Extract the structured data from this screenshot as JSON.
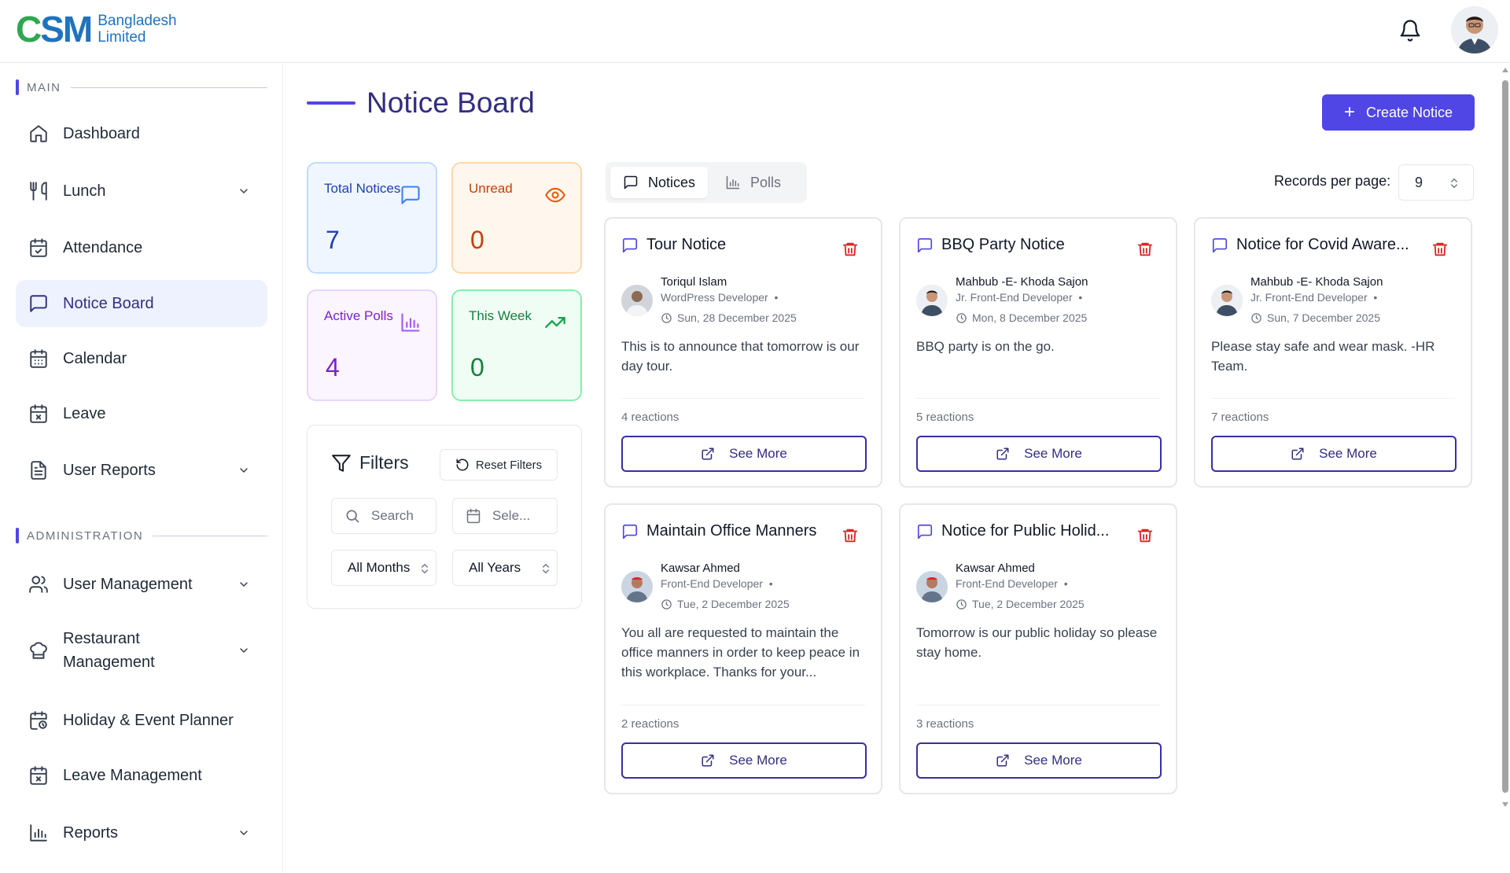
{
  "brand": {
    "mark_c": "C",
    "mark_sm": "SM",
    "line1": "Bangladesh",
    "line2": "Limited"
  },
  "sidebar": {
    "main_label": "MAIN",
    "admin_label": "ADMINISTRATION",
    "items": [
      {
        "label": "Dashboard",
        "icon": "home-icon"
      },
      {
        "label": "Lunch",
        "icon": "utensils-icon"
      },
      {
        "label": "Attendance",
        "icon": "calendar-check-icon"
      },
      {
        "label": "Notice Board",
        "icon": "message-square-icon"
      },
      {
        "label": "Calendar",
        "icon": "calendar-icon"
      },
      {
        "label": "Leave",
        "icon": "calendar-x-icon"
      },
      {
        "label": "User Reports",
        "icon": "file-text-icon"
      }
    ],
    "admin_items": [
      {
        "label": "User Management",
        "icon": "users-icon"
      },
      {
        "label": "Restaurant",
        "label2": "Management",
        "icon": "chef-hat-icon"
      },
      {
        "label": "Holiday & Event Planner",
        "icon": "calendar-clock-icon"
      },
      {
        "label": "Leave Management",
        "icon": "calendar-x-icon"
      },
      {
        "label": "Reports",
        "icon": "bar-chart-icon"
      }
    ]
  },
  "page": {
    "title": "Notice Board",
    "create_label": "Create Notice"
  },
  "stats": [
    {
      "label": "Total Notices",
      "value": "7",
      "icon": "message-square-icon",
      "color": "#1e40af"
    },
    {
      "label": "Unread",
      "value": "0",
      "icon": "eye-icon",
      "color": "#c2410c"
    },
    {
      "label": "Active Polls",
      "value": "4",
      "icon": "bar-chart-icon",
      "color": "#7e22ce"
    },
    {
      "label": "This Week",
      "value": "0",
      "icon": "trending-up-icon",
      "color": "#15803d"
    }
  ],
  "filters": {
    "title": "Filters",
    "reset_label": "Reset Filters",
    "search_placeholder": "Search",
    "date_placeholder": "Sele...",
    "month_value": "All Months",
    "year_value": "All Years"
  },
  "tabs": [
    {
      "label": "Notices"
    },
    {
      "label": "Polls"
    }
  ],
  "records_per_page": {
    "label": "Records per page:",
    "value": "9"
  },
  "notices": [
    {
      "title": "Tour Notice",
      "author": "Toriqul Islam",
      "role": "WordPress Developer",
      "date": "Sun, 28 December 2025",
      "body": "This is to announce that tomorrow is our day tour.",
      "reactions": "4 reactions",
      "action": "See More"
    },
    {
      "title": "BBQ Party Notice",
      "author": "Mahbub -E- Khoda Sajon",
      "role": "Jr. Front-End Developer",
      "date": "Mon, 8 December 2025",
      "body": "BBQ party is on the go.",
      "reactions": "5 reactions",
      "action": "See More"
    },
    {
      "title": "Notice for Covid Aware...",
      "author": "Mahbub -E- Khoda Sajon",
      "role": "Jr. Front-End Developer",
      "date": "Sun, 7 December 2025",
      "body": "Please stay safe and wear mask. -HR Team.",
      "reactions": "7 reactions",
      "action": "See More"
    },
    {
      "title": "Maintain Office Manners",
      "author": "Kawsar Ahmed",
      "role": "Front-End Developer",
      "date": "Tue, 2 December 2025",
      "body": "You all are requested to maintain the office manners in order to keep peace in this workplace. Thanks for your...",
      "reactions": "2 reactions",
      "action": "See More"
    },
    {
      "title": "Notice for Public Holid...",
      "author": "Kawsar Ahmed",
      "role": "Front-End Developer",
      "date": "Tue, 2 December 2025",
      "body": "Tomorrow is our public holiday so please stay home.",
      "reactions": "3 reactions",
      "action": "See More"
    }
  ],
  "colors": {
    "accent": "#4f46e5",
    "danger": "#dc2626"
  }
}
